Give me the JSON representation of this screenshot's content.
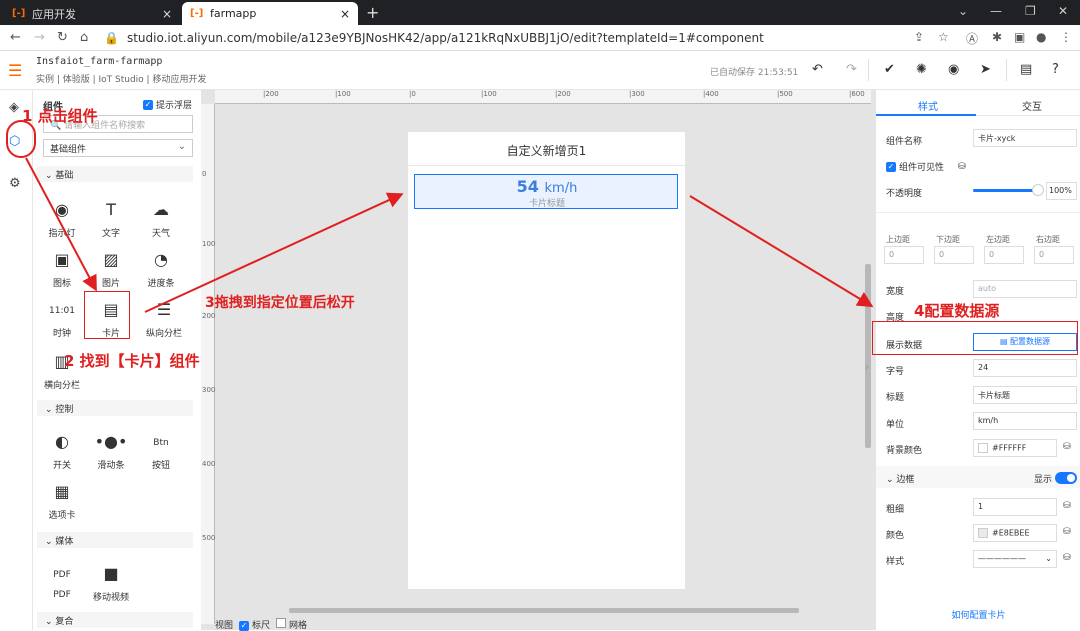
{
  "browser": {
    "tabs": [
      {
        "label": "应用开发",
        "icon": "aliyun-icon",
        "close": "×"
      },
      {
        "label": "farmapp",
        "icon": "aliyun-icon",
        "close": "×"
      }
    ],
    "new_tab": "+",
    "url": "studio.iot.aliyun.com/mobile/a123e9YBJNosHK42/app/a121kRqNxUBBJ1jO/edit?templateId=1#component"
  },
  "header": {
    "project": "Insfaiot_farm-farmapp",
    "breadcrumb": "实例 | 体验版 | IoT Studio | 移动应用开发",
    "saved": "已自动保存 21:53:51"
  },
  "components_panel": {
    "title": "组件",
    "show_float": "提示浮层",
    "search_placeholder": "请输入组件名称搜索",
    "category": "基础组件",
    "groups": {
      "basic": "基础",
      "control": "控制",
      "media": "媒体",
      "composite": "复合"
    },
    "basic_items": [
      "指示灯",
      "文字",
      "天气",
      "图标",
      "图片",
      "进度条",
      "时钟",
      "卡片",
      "纵向分栏",
      "横向分栏"
    ],
    "control_items": [
      "开关",
      "滑动条",
      "按钮",
      "选项卡"
    ],
    "media_items": [
      "PDF",
      "移动视频"
    ],
    "clock_glyph": "11:01",
    "btn_glyph": "Btn",
    "pdf_glyph": "PDF"
  },
  "canvas": {
    "ruler_h": [
      "|200",
      "|100",
      "|0",
      "|100",
      "|200",
      "|300",
      "|400",
      "|500",
      "|600"
    ],
    "ruler_v": [
      "0",
      "100",
      "200",
      "300",
      "400",
      "500"
    ],
    "page_title": "自定义新增页1",
    "card": {
      "value": "54",
      "unit": "km/h",
      "title": "卡片标题"
    },
    "footer": {
      "view": "视图",
      "ruler": "标尺",
      "grid": "网格"
    }
  },
  "props": {
    "tabs": [
      "样式",
      "交互"
    ],
    "name_label": "组件名称",
    "name_value": "卡片-xyck",
    "visible_label": "组件可见性",
    "opacity_label": "不透明度",
    "opacity_value": "100%",
    "opacity": 1.0,
    "margins": [
      "上边距",
      "下边距",
      "左边距",
      "右边距"
    ],
    "margin_values": [
      "0",
      "0",
      "0",
      "0"
    ],
    "width_label": "宽度",
    "width_placeholder": "auto",
    "height_label": "高度",
    "data_label": "展示数据",
    "data_button": "配置数据源",
    "fontsize_label": "字号",
    "fontsize_value": "24",
    "title_label": "标题",
    "title_value": "卡片标题",
    "unit_label": "单位",
    "unit_value": "km/h",
    "bg_label": "背景颜色",
    "bg_value": "#FFFFFF",
    "border_section": "边框",
    "border_show": "显示",
    "thick_label": "粗细",
    "thick_value": "1",
    "color_label": "颜色",
    "color_value": "#E8EBEE",
    "style_label": "样式",
    "help_link": "如何配置卡片"
  },
  "annotations": {
    "step1": "1 点击组件",
    "step2": "2 找到【卡片】组件",
    "step3": "3拖拽到指定位置后松开",
    "step4": "4配置数据源"
  },
  "colors": {
    "accent": "#1677ff",
    "annotation": "#e02020",
    "brand": "#ff6a00"
  }
}
